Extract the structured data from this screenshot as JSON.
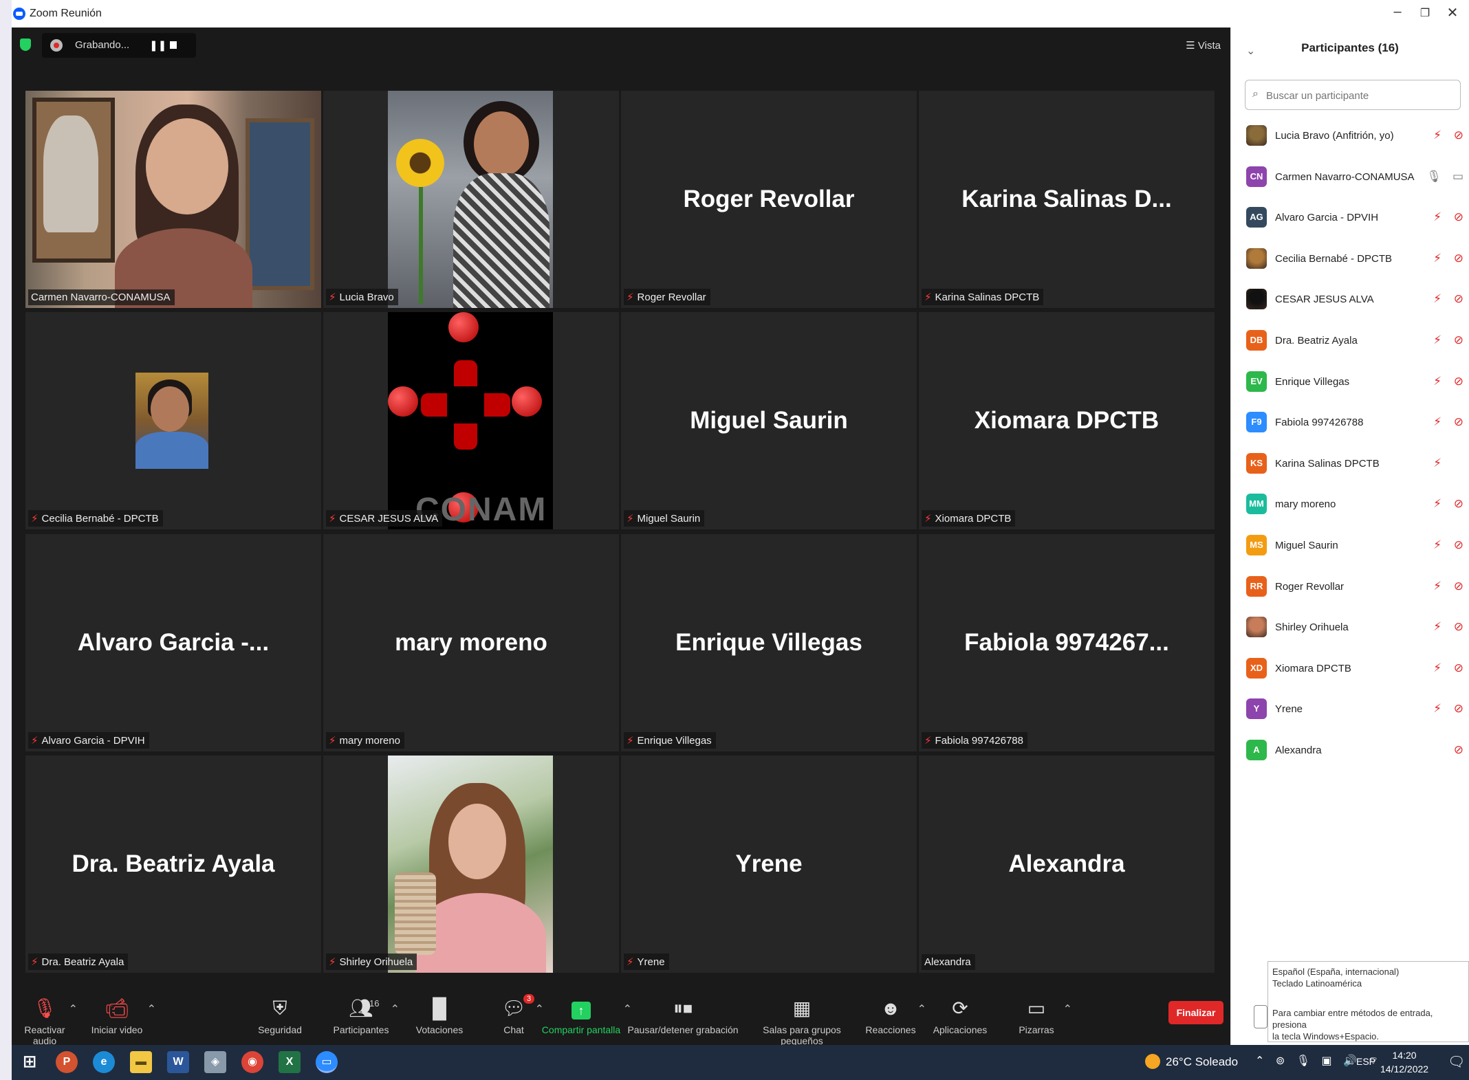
{
  "window": {
    "title": "Zoom Reunión",
    "controls": [
      "–",
      "❐",
      "✕"
    ]
  },
  "topbar": {
    "recording_label": "Grabando...",
    "pause_glyph": "❚❚",
    "view_label": "☰ Vista"
  },
  "tiles": [
    {
      "name": "",
      "label": "Carmen Navarro-CONAMUSA",
      "muted": false
    },
    {
      "name": "",
      "label": "Lucia Bravo",
      "muted": true
    },
    {
      "name": "Roger Revollar",
      "label": "Roger Revollar",
      "muted": true
    },
    {
      "name": "Karina Salinas D...",
      "label": "Karina Salinas DPCTB",
      "muted": true
    },
    {
      "name": "",
      "label": "Cecilia Bernabé - DPCTB",
      "muted": true
    },
    {
      "name": "",
      "label": "CESAR JESUS ALVA",
      "muted": true,
      "logo_text": "CONAM"
    },
    {
      "name": "Miguel Saurin",
      "label": "Miguel Saurin",
      "muted": true
    },
    {
      "name": "Xiomara DPCTB",
      "label": "Xiomara DPCTB",
      "muted": true
    },
    {
      "name": "Alvaro Garcia -...",
      "label": "Alvaro Garcia - DPVIH",
      "muted": true
    },
    {
      "name": "mary moreno",
      "label": "mary moreno",
      "muted": true
    },
    {
      "name": "Enrique Villegas",
      "label": "Enrique Villegas",
      "muted": true
    },
    {
      "name": "Fabiola 9974267...",
      "label": "Fabiola 997426788",
      "muted": true
    },
    {
      "name": "Dra. Beatriz Ayala",
      "label": "Dra. Beatriz Ayala",
      "muted": true
    },
    {
      "name": "",
      "label": "Shirley Orihuela",
      "muted": true
    },
    {
      "name": "Yrene",
      "label": "Yrene",
      "muted": true
    },
    {
      "name": "Alexandra",
      "label": "Alexandra",
      "muted": false
    }
  ],
  "toolbar": {
    "audio": "Reactivar audio",
    "video": "Iniciar video",
    "security": "Seguridad",
    "participants": "Participantes",
    "participants_count": "16",
    "polls": "Votaciones",
    "chat": "Chat",
    "chat_badge": "3",
    "share": "Compartir pantalla",
    "recording": "Pausar/detener grabación",
    "breakout": "Salas para grupos pequeños",
    "reactions": "Reacciones",
    "apps": "Aplicaciones",
    "whiteboards": "Pizarras",
    "end": "Finalizar"
  },
  "panel": {
    "title": "Participantes (16)",
    "search_placeholder": "Buscar un participante",
    "participants": [
      {
        "initials": "",
        "name": "Lucia Bravo (Anfitrión, yo)",
        "color": "#8a6b3a",
        "photo": true,
        "mic": "muted",
        "cam": "off"
      },
      {
        "initials": "CN",
        "name": "Carmen Navarro-CONAMUSA",
        "color": "#8e44ad",
        "photo": false,
        "mic": "on",
        "cam": "on"
      },
      {
        "initials": "AG",
        "name": "Alvaro Garcia - DPVIH",
        "color": "#34495e",
        "photo": false,
        "mic": "muted",
        "cam": "off"
      },
      {
        "initials": "",
        "name": "Cecilia Bernabé - DPCTB",
        "color": "#b07a3a",
        "photo": true,
        "mic": "muted",
        "cam": "off"
      },
      {
        "initials": "",
        "name": "CESAR JESUS ALVA",
        "color": "#111111",
        "photo": true,
        "mic": "muted",
        "cam": "off"
      },
      {
        "initials": "DB",
        "name": "Dra. Beatriz Ayala",
        "color": "#e8611a",
        "photo": false,
        "mic": "muted",
        "cam": "off"
      },
      {
        "initials": "EV",
        "name": "Enrique Villegas",
        "color": "#2eb84b",
        "photo": false,
        "mic": "muted",
        "cam": "off"
      },
      {
        "initials": "F9",
        "name": "Fabiola 997426788",
        "color": "#2d8cff",
        "photo": false,
        "mic": "muted",
        "cam": "off"
      },
      {
        "initials": "KS",
        "name": "Karina Salinas DPCTB",
        "color": "#e8611a",
        "photo": false,
        "mic": "muted",
        "cam": "none"
      },
      {
        "initials": "MM",
        "name": "mary moreno",
        "color": "#1abc9c",
        "photo": false,
        "mic": "muted",
        "cam": "off"
      },
      {
        "initials": "MS",
        "name": "Miguel Saurin",
        "color": "#f39c12",
        "photo": false,
        "mic": "muted",
        "cam": "off"
      },
      {
        "initials": "RR",
        "name": "Roger Revollar",
        "color": "#e8611a",
        "photo": false,
        "mic": "muted",
        "cam": "off"
      },
      {
        "initials": "",
        "name": "Shirley Orihuela",
        "color": "#c77d5a",
        "photo": true,
        "mic": "muted",
        "cam": "off"
      },
      {
        "initials": "XD",
        "name": "Xiomara DPCTB",
        "color": "#e8611a",
        "photo": false,
        "mic": "muted",
        "cam": "off"
      },
      {
        "initials": "Y",
        "name": "Yrene",
        "color": "#8e44ad",
        "photo": false,
        "mic": "muted",
        "cam": "off"
      },
      {
        "initials": "A",
        "name": "Alexandra",
        "color": "#2eb84b",
        "photo": false,
        "mic": "none",
        "cam": "off"
      }
    ]
  },
  "ime_popup": {
    "line1": "Español (España, internacional)",
    "line2": "Teclado Latinoamérica",
    "line3": "Para cambiar entre métodos de entrada, presiona",
    "line4": "la tecla Windows+Espacio."
  },
  "taskbar": {
    "weather": "26°C Soleado",
    "lang": "ESP",
    "time": "14:20",
    "date": "14/12/2022"
  }
}
